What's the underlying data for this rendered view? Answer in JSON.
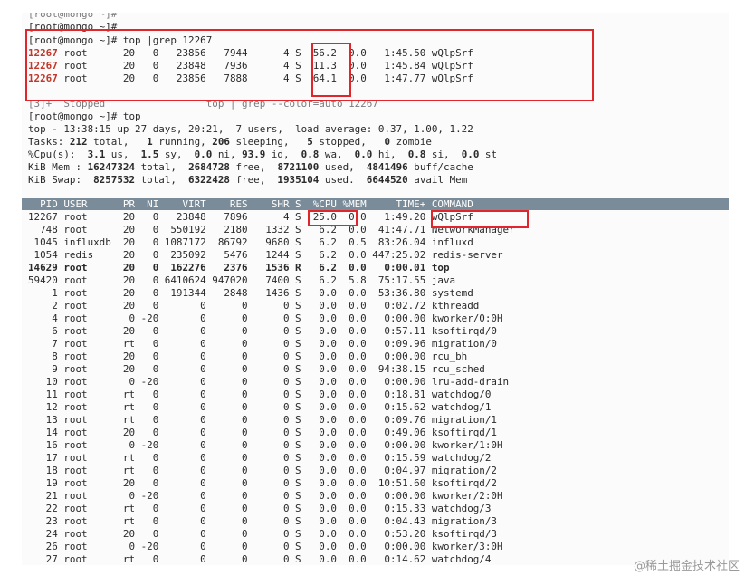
{
  "terminal": {
    "top_prompts": [
      "[root@mongo ~]#",
      "[root@mongo ~]#"
    ],
    "grep_command": "[root@mongo ~]# top |grep 12267",
    "grep_rows": [
      {
        "pid": "12267",
        "rest": " root      20   0   23856   7944      4 S  56.2  0.0   1:45.50 wQlpSrf"
      },
      {
        "pid": "12267",
        "rest": " root      20   0   23848   7936      4 S  11.3  0.0   1:45.84 wQlpSrf"
      },
      {
        "pid": "12267",
        "rest": " root      20   0   23856   7888      4 S  64.1  0.0   1:47.77 wQlpSrf"
      }
    ],
    "stopped_line": "[3]+  Stopped                 top | grep --color=auto 12267",
    "top_command": "[root@mongo ~]# top",
    "summary": {
      "uptime": "top - 13:38:15 up 27 days, 20:21,  7 users,  load average: 0.37, 1.00, 1.22",
      "tasks_label": "Tasks: ",
      "tasks_total": "212",
      "tasks_mid1": " total,   ",
      "tasks_running": "1",
      "tasks_mid2": " running, ",
      "tasks_sleeping": "206",
      "tasks_mid3": " sleeping,   ",
      "tasks_stopped": "5",
      "tasks_mid4": " stopped,   ",
      "tasks_zombie": "0",
      "tasks_end": " zombie",
      "cpu_label": "%Cpu(s):  ",
      "cpu_us": "3.1",
      "cpu_us_t": " us,  ",
      "cpu_sy": "1.5",
      "cpu_sy_t": " sy,  ",
      "cpu_ni": "0.0",
      "cpu_ni_t": " ni, ",
      "cpu_id": "93.9",
      "cpu_id_t": " id,  ",
      "cpu_wa": "0.8",
      "cpu_wa_t": " wa,  ",
      "cpu_hi": "0.0",
      "cpu_hi_t": " hi,  ",
      "cpu_si": "0.8",
      "cpu_si_t": " si,  ",
      "cpu_st": "0.0",
      "cpu_st_t": " st",
      "mem_label": "KiB Mem : ",
      "mem_total": "16247324",
      "mem_total_t": " total,  ",
      "mem_free": "2684728",
      "mem_free_t": " free,  ",
      "mem_used": "8721100",
      "mem_used_t": " used,  ",
      "mem_cache": "4841496",
      "mem_cache_t": " buff/cache",
      "swap_label": "KiB Swap:  ",
      "swap_total": "8257532",
      "swap_total_t": " total,  ",
      "swap_free": "6322428",
      "swap_free_t": " free,  ",
      "swap_used": "1935104",
      "swap_used_t": " used.  ",
      "swap_avail": "6644520",
      "swap_avail_t": " avail Mem"
    },
    "table_header": "  PID USER      PR  NI    VIRT    RES    SHR S  %CPU %MEM     TIME+ COMMAND",
    "processes": [
      {
        "text": "12267 root      20   0   23848   7896      4 S  25.0  0.0   1:49.20 wQlpSrf",
        "bold": false
      },
      {
        "text": "  748 root      20   0  550192   2180   1332 S   6.2  0.0  41:47.71 NetworkManager",
        "bold": false
      },
      {
        "text": " 1045 influxdb  20   0 1087172  86792   9680 S   6.2  0.5  83:26.04 influxd",
        "bold": false
      },
      {
        "text": " 1054 redis     20   0  235092   5476   1244 S   6.2  0.0 447:25.02 redis-server",
        "bold": false
      },
      {
        "text": "14629 root      20   0  162276   2376   1536 R   6.2  0.0   0:00.01 top",
        "bold": true
      },
      {
        "text": "59420 root      20   0 6410624 947020   7400 S   6.2  5.8  75:17.55 java",
        "bold": false
      },
      {
        "text": "    1 root      20   0  191344   2848   1436 S   0.0  0.0  53:36.80 systemd",
        "bold": false
      },
      {
        "text": "    2 root      20   0       0      0      0 S   0.0  0.0   0:02.72 kthreadd",
        "bold": false
      },
      {
        "text": "    4 root       0 -20       0      0      0 S   0.0  0.0   0:00.00 kworker/0:0H",
        "bold": false
      },
      {
        "text": "    6 root      20   0       0      0      0 S   0.0  0.0   0:57.11 ksoftirqd/0",
        "bold": false
      },
      {
        "text": "    7 root      rt   0       0      0      0 S   0.0  0.0   0:09.96 migration/0",
        "bold": false
      },
      {
        "text": "    8 root      20   0       0      0      0 S   0.0  0.0   0:00.00 rcu_bh",
        "bold": false
      },
      {
        "text": "    9 root      20   0       0      0      0 S   0.0  0.0  94:38.15 rcu_sched",
        "bold": false
      },
      {
        "text": "   10 root       0 -20       0      0      0 S   0.0  0.0   0:00.00 lru-add-drain",
        "bold": false
      },
      {
        "text": "   11 root      rt   0       0      0      0 S   0.0  0.0   0:18.81 watchdog/0",
        "bold": false
      },
      {
        "text": "   12 root      rt   0       0      0      0 S   0.0  0.0   0:15.62 watchdog/1",
        "bold": false
      },
      {
        "text": "   13 root      rt   0       0      0      0 S   0.0  0.0   0:09.76 migration/1",
        "bold": false
      },
      {
        "text": "   14 root      20   0       0      0      0 S   0.0  0.0   0:49.06 ksoftirqd/1",
        "bold": false
      },
      {
        "text": "   16 root       0 -20       0      0      0 S   0.0  0.0   0:00.00 kworker/1:0H",
        "bold": false
      },
      {
        "text": "   17 root      rt   0       0      0      0 S   0.0  0.0   0:15.59 watchdog/2",
        "bold": false
      },
      {
        "text": "   18 root      rt   0       0      0      0 S   0.0  0.0   0:04.97 migration/2",
        "bold": false
      },
      {
        "text": "   19 root      20   0       0      0      0 S   0.0  0.0  10:51.60 ksoftirqd/2",
        "bold": false
      },
      {
        "text": "   21 root       0 -20       0      0      0 S   0.0  0.0   0:00.00 kworker/2:0H",
        "bold": false
      },
      {
        "text": "   22 root      rt   0       0      0      0 S   0.0  0.0   0:15.33 watchdog/3",
        "bold": false
      },
      {
        "text": "   23 root      rt   0       0      0      0 S   0.0  0.0   0:04.43 migration/3",
        "bold": false
      },
      {
        "text": "   24 root      20   0       0      0      0 S   0.0  0.0   0:53.20 ksoftirqd/3",
        "bold": false
      },
      {
        "text": "   26 root       0 -20       0      0      0 S   0.0  0.0   0:00.00 kworker/3:0H",
        "bold": false
      },
      {
        "text": "   27 root      rt   0       0      0      0 S   0.0  0.0   0:14.62 watchdog/4",
        "bold": false
      }
    ]
  },
  "watermark": "@稀土掘金技术社区",
  "colors": {
    "annotation_box": "#e0262a",
    "pid_highlight": "#c0392b",
    "header_bar": "#7a8c99"
  }
}
